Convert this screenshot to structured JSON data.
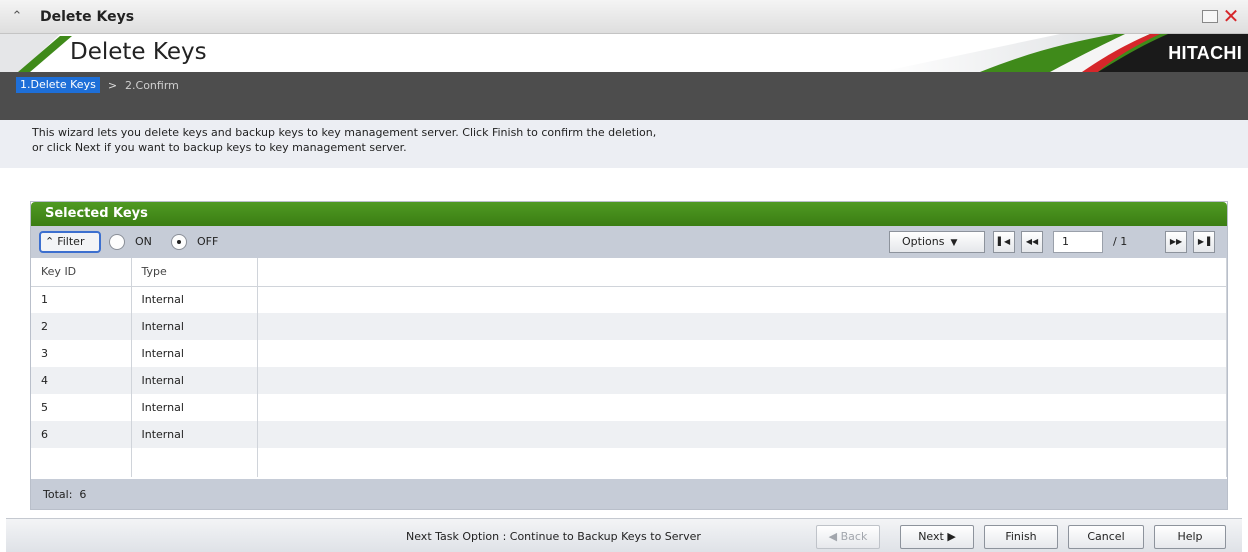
{
  "window": {
    "title": "Delete Keys",
    "collapse_icon": "double-chevron-up-icon",
    "maximize_icon": "maximize-icon",
    "close_icon": "close-icon"
  },
  "banner": {
    "heading": "Delete Keys",
    "brand": "HITACHI",
    "brand_color": "#d6262a",
    "accent_green": "#3f8a1a"
  },
  "wizard": {
    "steps": [
      {
        "label": "1.Delete Keys",
        "active": true
      },
      {
        "label": "2.Confirm",
        "active": false
      }
    ],
    "separator": ">",
    "description_line1": "This wizard lets you delete keys and backup keys to key management server. Click Finish to confirm the deletion,",
    "description_line2": "or click Next if you want to backup keys to key management server."
  },
  "panel": {
    "title": "Selected Keys",
    "filter": {
      "label": "Filter",
      "on_label": "ON",
      "off_label": "OFF",
      "selected": "OFF"
    },
    "options_label": "Options",
    "pagination": {
      "current_page": "1",
      "total_pages": "/ 1"
    },
    "columns": [
      "Key ID",
      "Type"
    ],
    "rows": [
      {
        "key_id": "1",
        "type": "Internal"
      },
      {
        "key_id": "2",
        "type": "Internal"
      },
      {
        "key_id": "3",
        "type": "Internal"
      },
      {
        "key_id": "4",
        "type": "Internal"
      },
      {
        "key_id": "5",
        "type": "Internal"
      },
      {
        "key_id": "6",
        "type": "Internal"
      }
    ],
    "total_label": "Total:",
    "total_value": "6"
  },
  "footer": {
    "next_task_option": "Next Task Option : Continue to Backup Keys to Server",
    "back_label": "Back",
    "next_label": "Next",
    "finish_label": "Finish",
    "cancel_label": "Cancel",
    "help_label": "Help"
  }
}
